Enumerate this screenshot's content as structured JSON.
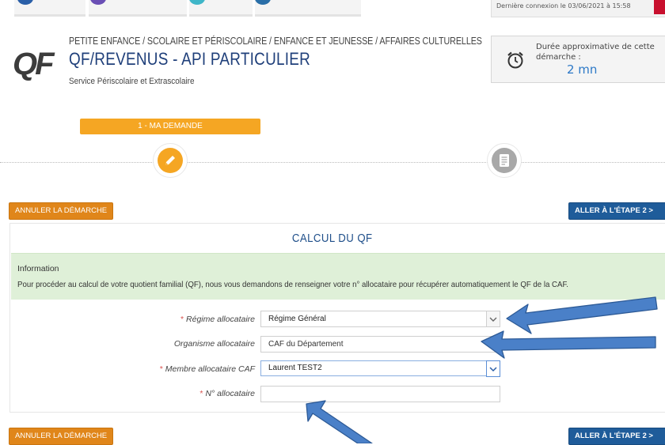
{
  "header": {
    "last_login": "Dernière connexion le 03/06/2021 à 15:58",
    "breadcrumb": "PETITE ENFANCE / SCOLAIRE ET PÉRISCOLAIRE / ENFANCE ET JEUNESSE / AFFAIRES CULTURELLES",
    "title": "QF/REVENUS - API PARTICULIER",
    "service": "Service Périscolaire et Extrascolaire",
    "logo_text": "QF",
    "logo_icon": "qf-logo"
  },
  "duration": {
    "label": "Durée approximative de cette démarche :",
    "value": "2 mn",
    "icon": "alarm-clock-icon"
  },
  "steps": {
    "current_label": "1 - MA DEMANDE",
    "step1_icon": "pencil-icon",
    "step2_icon": "document-icon"
  },
  "actions": {
    "cancel_label": "ANNULER LA DÉMARCHE",
    "next_label": "ALLER À L'ÉTAPE 2 >"
  },
  "form": {
    "title": "CALCUL DU QF",
    "info_title": "Information",
    "info_text": "Pour procéder au calcul de votre quotient familial (QF), nous vous demandons de renseigner votre n° allocataire pour récupérer automatiquement le QF de la CAF.",
    "required_mark": "*",
    "fields": {
      "regime_label": "Régime allocataire",
      "regime_value": "Régime Général",
      "organisme_label": "Organisme allocataire",
      "organisme_value": "CAF du Département",
      "membre_label": "Membre allocataire CAF",
      "membre_value": "Laurent TEST2",
      "numero_label": "N° allocataire",
      "numero_value": ""
    }
  },
  "colors": {
    "accent_orange": "#f5a623",
    "cancel_orange": "#e0861a",
    "primary_blue": "#1f5c9a",
    "title_blue": "#1f3f7a",
    "info_green": "#dff0d8",
    "annotation_arrow": "#4a80c8"
  }
}
